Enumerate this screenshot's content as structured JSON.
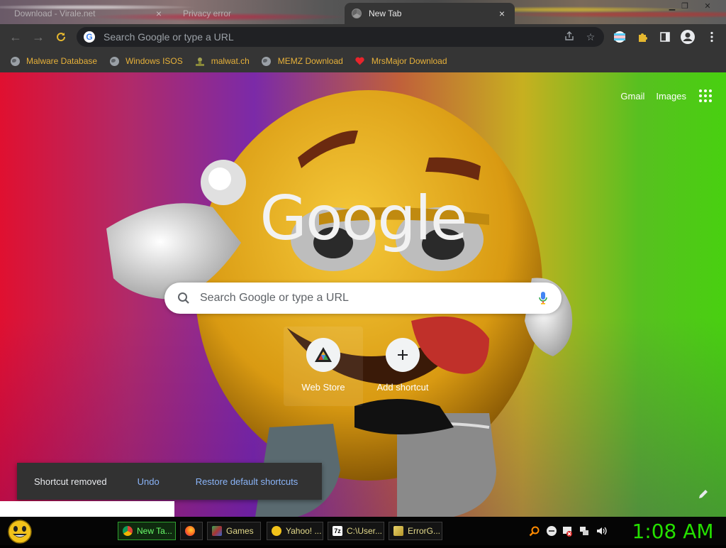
{
  "window": {
    "tabs": [
      {
        "title": "Download - Virale.net",
        "state": "inactive"
      },
      {
        "title": "Privacy error",
        "state": "inactive"
      },
      {
        "title": "New Tab",
        "state": "active"
      }
    ],
    "close_glyph": "×",
    "controls": [
      "minimize",
      "restore",
      "close"
    ]
  },
  "toolbar": {
    "omnibox_placeholder": "Search Google or type a URL",
    "icons": [
      "back-icon",
      "forward-icon",
      "reload-icon",
      "share-icon",
      "star-icon",
      "flag-extension-icon",
      "extensions-puzzle-icon",
      "side-panel-icon",
      "profile-icon",
      "menu-icon"
    ]
  },
  "bookmarks": [
    {
      "label": "Malware Database",
      "icon": "globe-icon"
    },
    {
      "label": "Windows ISOS",
      "icon": "globe-icon"
    },
    {
      "label": "malwat.ch",
      "icon": "malwatch-icon"
    },
    {
      "label": "MEMZ Download",
      "icon": "globe-icon"
    },
    {
      "label": "MrsMajor Download",
      "icon": "heart-icon"
    }
  ],
  "ntp": {
    "links": {
      "gmail": "Gmail",
      "images": "Images"
    },
    "logo_text": "Google",
    "search_placeholder": "Search Google or type a URL",
    "shortcuts": [
      {
        "label": "Web Store",
        "icon": "web-store-icon"
      },
      {
        "label": "Add shortcut",
        "icon": "plus-icon"
      }
    ],
    "toast": {
      "message": "Shortcut removed",
      "undo": "Undo",
      "restore": "Restore default shortcuts"
    }
  },
  "taskbar": {
    "tasks": [
      {
        "label": "New Ta...",
        "icon": "chrome-icon",
        "active": true
      },
      {
        "label": "",
        "icon": "firefox-icon",
        "active": false
      },
      {
        "label": "Games",
        "icon": "games-icon",
        "active": false
      },
      {
        "label": "Yahoo! ...",
        "icon": "yahoo-emoji-icon",
        "active": false
      },
      {
        "label": "C:\\User...",
        "icon": "7zip-icon",
        "active": false
      },
      {
        "label": "ErrorG...",
        "icon": "errorgen-icon",
        "active": false
      }
    ],
    "tray_icons": [
      "search-icon",
      "messenger-icon",
      "security-flag-icon",
      "network-icon",
      "volume-icon"
    ],
    "clock": "1:08 AM"
  },
  "colors": {
    "bookmark_text": "#e7b13a",
    "chrome_dark": "#353535",
    "clock_green": "#25e000",
    "toast_link": "#8ab4f8"
  }
}
